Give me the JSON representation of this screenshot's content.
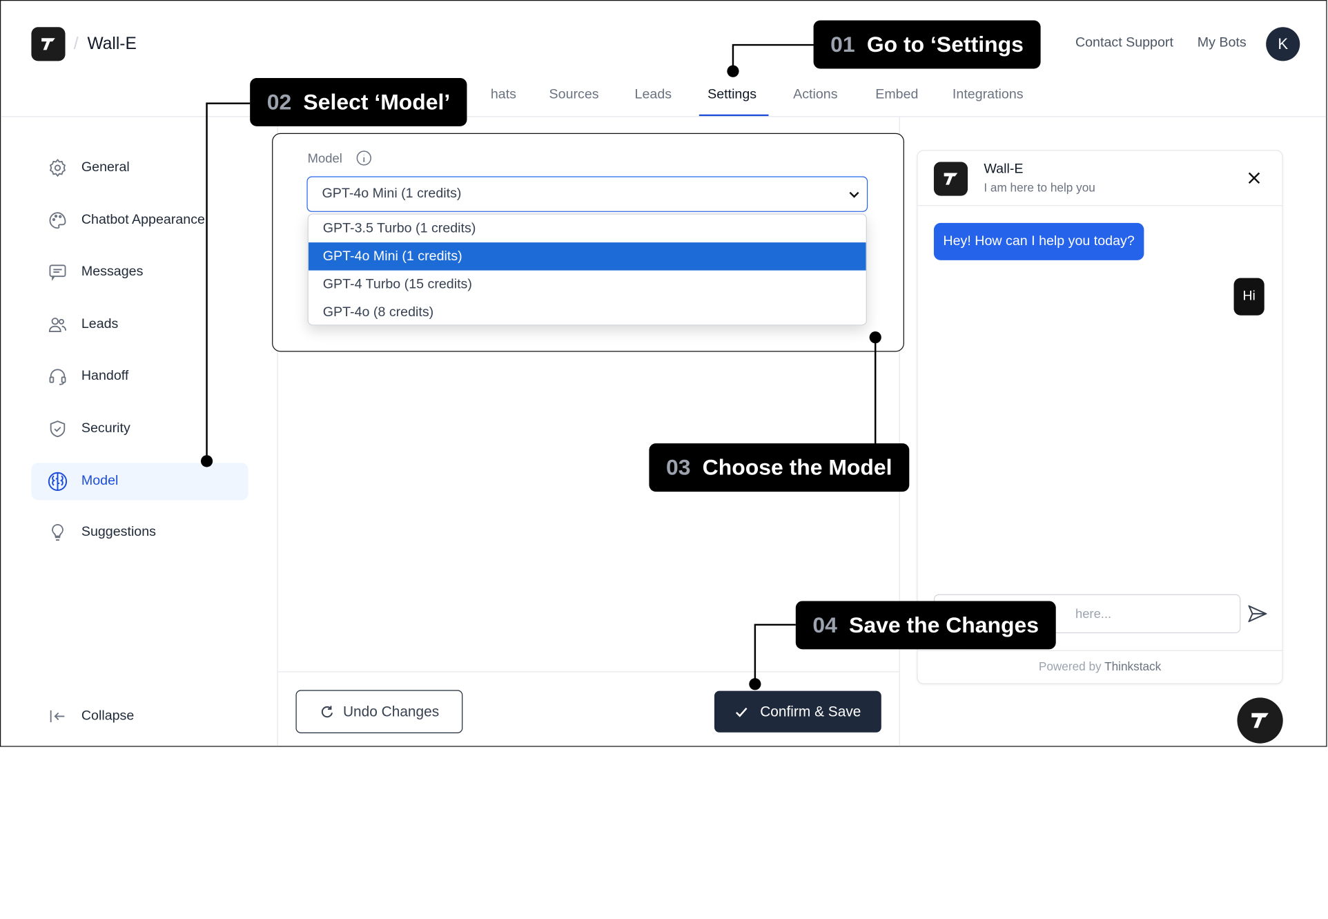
{
  "header": {
    "separator": "/",
    "bot_name": "Wall-E",
    "links": [
      "Contact Support",
      "My Bots"
    ],
    "avatar_initial": "K"
  },
  "tabs": [
    {
      "label": "hats"
    },
    {
      "label": "Sources"
    },
    {
      "label": "Leads"
    },
    {
      "label": "Settings",
      "active": true
    },
    {
      "label": "Actions"
    },
    {
      "label": "Embed"
    },
    {
      "label": "Integrations"
    }
  ],
  "sidebar": {
    "items": [
      {
        "label": "General",
        "icon": "gear-icon"
      },
      {
        "label": "Chatbot Appearance",
        "icon": "palette-icon"
      },
      {
        "label": "Messages",
        "icon": "message-icon"
      },
      {
        "label": "Leads",
        "icon": "users-icon"
      },
      {
        "label": "Handoff",
        "icon": "headset-icon"
      },
      {
        "label": "Security",
        "icon": "shield-icon"
      },
      {
        "label": "Model",
        "icon": "brain-icon",
        "active": true
      },
      {
        "label": "Suggestions",
        "icon": "lightbulb-icon"
      }
    ],
    "collapse_label": "Collapse"
  },
  "model": {
    "label": "Model",
    "selected": "GPT-4o Mini (1 credits)",
    "options": [
      "GPT-3.5 Turbo (1 credits)",
      "GPT-4o Mini (1 credits)",
      "GPT-4 Turbo (15 credits)",
      "GPT-4o (8 credits)"
    ],
    "selected_index": 1
  },
  "footer": {
    "undo_label": "Undo Changes",
    "save_label": "Confirm & Save"
  },
  "callouts": [
    {
      "num": "01",
      "text": "Go to ‘Settings"
    },
    {
      "num": "02",
      "text": "Select  ‘Model’"
    },
    {
      "num": "03",
      "text": "Choose the Model"
    },
    {
      "num": "04",
      "text": "Save the Changes"
    }
  ],
  "chat": {
    "name": "Wall-E",
    "subtitle": "I am here to help you",
    "bot_message": "Hey! How can I help you today?",
    "user_message": "Hi",
    "input_placeholder_visible": "here...",
    "powered_prefix": "Powered by",
    "powered_brand": "Thinkstack"
  },
  "colors": {
    "accent": "#1d4ed8",
    "selected_option": "#1d6bd6",
    "callout_bg": "#000000",
    "save_button": "#1e293b"
  }
}
